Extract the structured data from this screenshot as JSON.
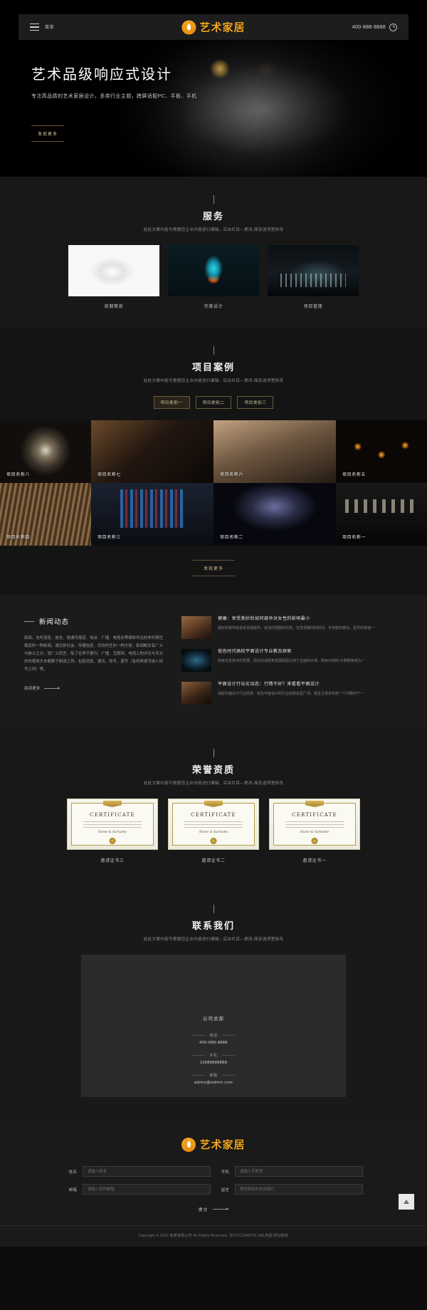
{
  "header": {
    "menu_label": "菜单",
    "brand": "艺术家居",
    "phone": "400-888-8888",
    "hamburger_icon": "hamburger-icon",
    "clock_icon": "clock-icon",
    "logo_icon": "flame-logo-icon",
    "accent_color": "#f3a81f"
  },
  "hero": {
    "title": "艺术品级响应式设计",
    "subtitle": "专注高品质的艺术家居设计，多类行业主题，跨屏适配PC、平板、手机",
    "cta": "发现更多"
  },
  "services": {
    "tick": "",
    "title": "服务",
    "subtitle": "此处文案内容可根据您企业内容进行编辑，后台栏目—更改-简张选项里修改",
    "cards": [
      {
        "label": "前期策划",
        "thumb": "tiger-roar-image"
      },
      {
        "label": "完美设计",
        "thumb": "light-bulb-image"
      },
      {
        "label": "项目管理",
        "thumb": "chess-board-image"
      }
    ]
  },
  "projects": {
    "title": "项目案例",
    "subtitle": "此处文案内容可根据您企业内容进行编辑，后台栏目—更改-简张选项里修改",
    "tabs": [
      {
        "label": "项目类别一",
        "active": true
      },
      {
        "label": "项目类别二",
        "active": false
      },
      {
        "label": "项目类别三",
        "active": false
      }
    ],
    "items": [
      {
        "label": "项目名称八",
        "image": "spiral-staircase-image"
      },
      {
        "label": "项目名称七",
        "image": "wooden-interior-image"
      },
      {
        "label": "项目名称六",
        "image": "living-room-image"
      },
      {
        "label": "项目名称五",
        "image": "edison-lamps-image"
      },
      {
        "label": "项目名称四",
        "image": "wooden-roof-image"
      },
      {
        "label": "项目名称三",
        "image": "stained-glass-image"
      },
      {
        "label": "项目名称二",
        "image": "draped-hall-image"
      },
      {
        "label": "项目名称一",
        "image": "art-gallery-image"
      }
    ],
    "more": "发现更多"
  },
  "news": {
    "title": "新闻动态",
    "body": "新闻，也叫消息，是也、是通讯报道、电台、广播、电视台等媒体传达的非时事性报道的一种新闻。通过新社会、传播信息、目的的任的一种文体，新闻概念有广义与狭义之分。就广义而言，除了社李子报刊、广播、互联网、电视上的评论与专文外的使用文本都属于新闻之列。包括消息、通讯、特写、速写（有的将速写纳入特写之列）等。",
    "more": "阅读更多",
    "items": [
      {
        "title": "健康：享受美妙后如何避孕对女性的影响最小",
        "desc": "最好的避孕就是安全期避孕，适当的把握好时机，在发现期间的时间、平安康存康也、型号的普遍一",
        "thumb": "architecture-thumb"
      },
      {
        "title": "低色时代高校平面设计专业教及探索",
        "desc": "随身信息技术的发展，现在的消费和发展取副以到了全面的水准。随身日到时•大致群等成为一",
        "thumb": "tunnel-thumb"
      },
      {
        "title": "平面设计行业劣动态：行情不好？来看看平面设计",
        "desc": "请起平面设计行业前景，就去平面设计的行业前景是否广阔。我且位很多时候一个问路的干一",
        "thumb": "interior-thumb"
      }
    ]
  },
  "honors": {
    "title": "荣誉资质",
    "subtitle": "此处文案内容可根据您企业内容进行编辑，后台栏目—更改-简张选项里修改",
    "certificate_heading": "CERTIFICATE",
    "certificate_sign": "Name & Surname",
    "items": [
      {
        "label": "邀请证书三"
      },
      {
        "label": "邀请证书二"
      },
      {
        "label": "邀请证书一"
      }
    ]
  },
  "contact": {
    "title": "联系我们",
    "subtitle": "此处文案内容可根据您企业内容进行编辑，后台栏目—更改-简张选项里修改",
    "hq": "公司总部",
    "map_icon": "map-outline-icon",
    "rows": [
      {
        "key": "电话",
        "value": "400-888-8888"
      },
      {
        "key": "手机",
        "value": "13588888888"
      },
      {
        "key": "邮箱",
        "value": "admin@admin.com"
      }
    ]
  },
  "footer": {
    "brand": "艺术家居",
    "fields": [
      {
        "label": "姓名",
        "placeholder": "请输入姓名",
        "value": ""
      },
      {
        "label": "手机",
        "placeholder": "请输入手机号",
        "value": ""
      },
      {
        "label": "邮箱",
        "placeholder": "请输入您的邮箱",
        "value": ""
      },
      {
        "label": "留言",
        "placeholder": "把您想说的告诉我们",
        "value": ""
      }
    ],
    "submit": "提交",
    "backtop_icon": "back-to-top-icon",
    "copyright": "Copyright © 2022 某某有限公司 All Rights Reserved. 苏ICP12345678 XML地图 网站模板"
  }
}
